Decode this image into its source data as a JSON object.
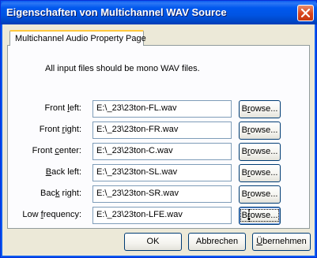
{
  "window": {
    "title": "Eigenschaften von Multichannel WAV Source"
  },
  "tab": {
    "label": "Multichannel Audio Property Page"
  },
  "note": "All input files should be mono WAV files.",
  "rows": [
    {
      "label_pre": "Front ",
      "label_u": "l",
      "label_post": "eft:",
      "value": "E:\\_23\\23ton-FL.wav",
      "browse_pre": "B",
      "browse_u": "r",
      "browse_post": "owse..."
    },
    {
      "label_pre": "Front ",
      "label_u": "r",
      "label_post": "ight:",
      "value": "E:\\_23\\23ton-FR.wav",
      "browse_pre": "B",
      "browse_u": "r",
      "browse_post": "owse..."
    },
    {
      "label_pre": "Front ",
      "label_u": "c",
      "label_post": "enter:",
      "value": "E:\\_23\\23ton-C.wav",
      "browse_pre": "B",
      "browse_u": "r",
      "browse_post": "owse..."
    },
    {
      "label_pre": "",
      "label_u": "B",
      "label_post": "ack left:",
      "value": "E:\\_23\\23ton-SL.wav",
      "browse_pre": "B",
      "browse_u": "r",
      "browse_post": "owse..."
    },
    {
      "label_pre": "Bac",
      "label_u": "k",
      "label_post": " right:",
      "value": "E:\\_23\\23ton-SR.wav",
      "browse_pre": "B",
      "browse_u": "r",
      "browse_post": "owse..."
    },
    {
      "label_pre": "Low ",
      "label_u": "f",
      "label_post": "requency:",
      "value": "E:\\_23\\23ton-LFE.wav",
      "browse_pre": "B",
      "browse_u": "r",
      "browse_post": "owse..."
    }
  ],
  "buttons": {
    "ok": "OK",
    "cancel": "Abbrechen",
    "apply_u": "Ü",
    "apply_rest": "bernehmen"
  },
  "icons": {
    "close": "close-icon"
  },
  "colors": {
    "titlebar": "#0054e3",
    "close": "#d8431c",
    "tab_highlight": "#ffc83c",
    "face": "#ece9d8"
  }
}
